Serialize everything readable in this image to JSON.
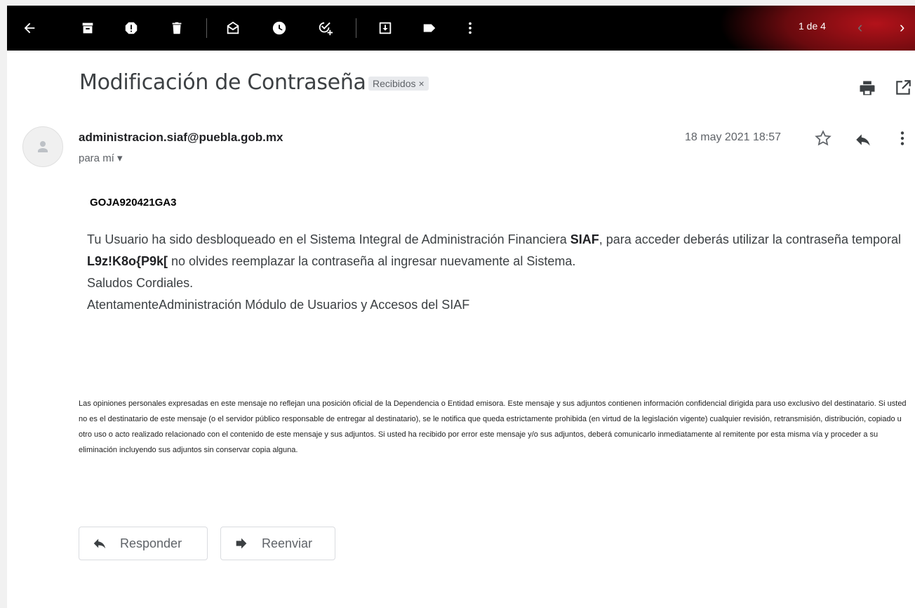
{
  "toolbar": {
    "icons": [
      "back-arrow-icon",
      "archive-icon",
      "report-spam-icon",
      "delete-icon",
      "mark-unread-icon",
      "snooze-icon",
      "add-task-icon",
      "move-to-icon",
      "label-icon",
      "more-vert-icon"
    ],
    "pager_text": "1 de 4",
    "prev_icon": "‹",
    "next_icon": "›"
  },
  "message": {
    "subject": "Modificación de Contraseña",
    "label": "Recibidos",
    "label_remove": "×",
    "sender_email": "administracion.siaf@puebla.gob.mx",
    "recipient": "para mí ▾",
    "date": "18 may 2021 18:57"
  },
  "body": {
    "code": "GOJA920421GA3",
    "p1_a": "Tu Usuario ha sido desbloqueado en el Sistema Integral de Administración Financiera ",
    "p1_b": "SIAF",
    "p1_c": ", para acceder deberás utilizar la contraseña temporal ",
    "p1_d": "L9z!K8o{P9k[",
    "p1_e": " no olvides reemplazar la contraseña al ingresar nuevamente al Sistema.",
    "line2": "Saludos Cordiales.",
    "line3": "AtentamenteAdministración Módulo de Usuarios y Accesos del SIAF"
  },
  "disclaimer": "Las opiniones personales expresadas en este mensaje no reflejan una posición oficial de la Dependencia o Entidad emisora. Este mensaje y sus adjuntos contienen información confidencial dirigida para uso exclusivo del destinatario. Si usted no es el destinatario de este mensaje (o el servidor público responsable de entregar al destinatario), se le notifica que queda estrictamente prohibida (en virtud de la legislación vigente) cualquier revisión, retransmisión, distribución, copiado u otro uso o acto realizado relacionado con el contenido de este mensaje y sus adjuntos. Si usted ha recibido por error este mensaje y/o sus adjuntos, deberá comunicarlo inmediatamente al remitente por esta misma vía y proceder a su eliminación incluyendo sus adjuntos sin conservar copia alguna.",
  "actions": {
    "reply_label": "Responder",
    "forward_label": "Reenviar"
  },
  "colors": {
    "toolbar_bg": "#000000",
    "accent_red": "#b3121a",
    "text_primary": "#202124",
    "text_secondary": "#5f6368"
  }
}
